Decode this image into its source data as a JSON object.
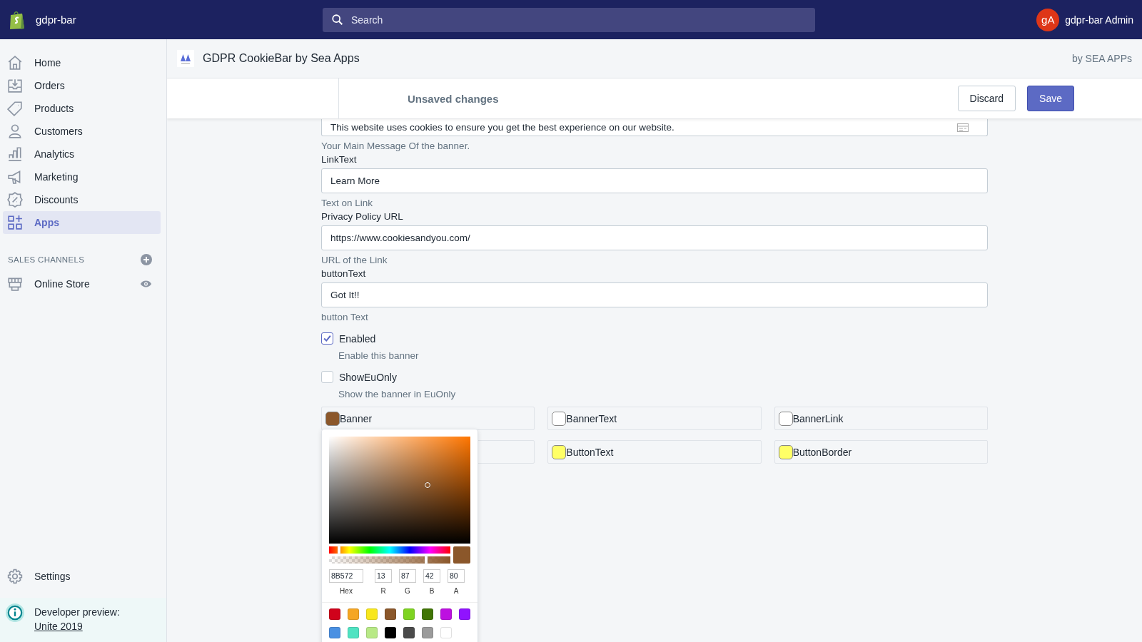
{
  "topbar": {
    "store_name": "gdpr-bar",
    "search": {
      "placeholder": "Search"
    },
    "avatar_initials": "gA",
    "user_name": "gdpr-bar Admin"
  },
  "sidebar": {
    "items": [
      {
        "label": "Home",
        "selected": false
      },
      {
        "label": "Orders",
        "selected": false
      },
      {
        "label": "Products",
        "selected": false
      },
      {
        "label": "Customers",
        "selected": false
      },
      {
        "label": "Analytics",
        "selected": false
      },
      {
        "label": "Marketing",
        "selected": false
      },
      {
        "label": "Discounts",
        "selected": false
      },
      {
        "label": "Apps",
        "selected": true
      }
    ],
    "sales_channels": {
      "heading": "SALES CHANNELS",
      "items": [
        {
          "label": "Online Store"
        }
      ]
    },
    "settings": "Settings",
    "developer_preview": {
      "label": "Developer preview:",
      "link": "Unite 2019"
    }
  },
  "app_header": {
    "title": "GDPR CookieBar by Sea Apps",
    "vendor": "by SEA APPs"
  },
  "save_bar": {
    "message": "Unsaved changes",
    "buttons": [
      {
        "label": "Discard",
        "kind": "secondary"
      },
      {
        "label": "Save",
        "kind": "primary"
      }
    ]
  },
  "form": {
    "message_value": "This website uses cookies to ensure you get the best experience on our website.",
    "message_help": "Your Main Message Of the banner.",
    "fields": [
      {
        "label": "LinkText",
        "value": "Learn More",
        "help": "Text on Link"
      },
      {
        "label": "Privacy Policy URL",
        "value": "https://www.cookiesandyou.com/",
        "help": "URL of the Link"
      },
      {
        "label": "buttonText",
        "value": "Got It!!",
        "help": "button Text"
      }
    ],
    "checkboxes": [
      {
        "label": "Enabled",
        "checked": true,
        "help": "Enable this banner"
      },
      {
        "label": "ShowEuOnly",
        "checked": false,
        "help": "Show the banner in EuOnly"
      }
    ],
    "color_fields": [
      {
        "label": "Banner",
        "color": "#8b572a"
      },
      {
        "label": "BannerText",
        "color": "#ffffff"
      },
      {
        "label": "BannerLink",
        "color": "#ffffff"
      },
      {
        "label": "ButtonText",
        "color": "#ffff66"
      },
      {
        "label": "ButtonBorder",
        "color": "#ffff66"
      }
    ]
  },
  "color_picker": {
    "hue_slider": {
      "level": 0.08
    },
    "alpha_slider": {
      "level": 0.8
    },
    "hex": "8B572",
    "r": "13",
    "g": "87",
    "b": "42",
    "a": "80",
    "labels": [
      "Hex",
      "R",
      "G",
      "B",
      "A"
    ],
    "presets": [
      {
        "color": "#d0021b"
      },
      {
        "color": "#f5a623"
      },
      {
        "color": "#f8e71c"
      },
      {
        "color": "#8b572a"
      },
      {
        "color": "#7ed321"
      },
      {
        "color": "#417505"
      },
      {
        "color": "#bd10e0"
      },
      {
        "color": "#9013fe"
      },
      {
        "color": "#4a90e2"
      },
      {
        "color": "#50e3c2"
      },
      {
        "color": "#b8e986"
      },
      {
        "color": "#000000"
      },
      {
        "color": "#4a4a4a"
      },
      {
        "color": "#9b9b9b"
      },
      {
        "color": "#ffffff"
      }
    ]
  }
}
